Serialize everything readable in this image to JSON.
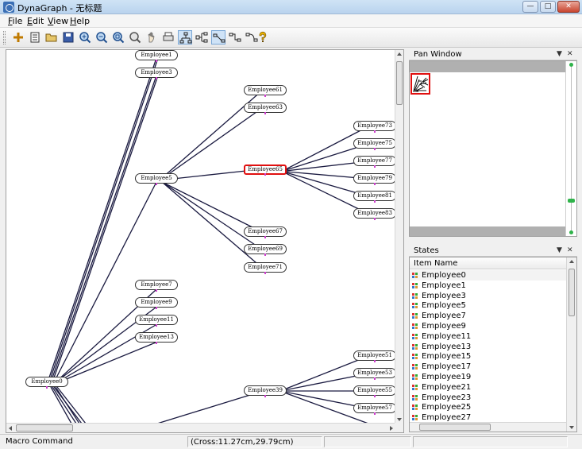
{
  "window": {
    "title": "DynaGraph - 无标题",
    "buttons": {
      "minimize": "—",
      "maximize": "□",
      "close": "✕"
    }
  },
  "menu": [
    "File",
    "Edit",
    "View",
    "Help"
  ],
  "toolbar": [
    {
      "name": "add-node",
      "icon": "plus-icon",
      "active": false
    },
    {
      "name": "properties",
      "icon": "document-list-icon",
      "active": false
    },
    {
      "name": "open",
      "icon": "folder-open-icon",
      "active": false
    },
    {
      "name": "save",
      "icon": "save-disk-icon",
      "active": false
    },
    {
      "name": "zoom-in",
      "icon": "zoom-in-icon",
      "active": false
    },
    {
      "name": "zoom-out",
      "icon": "zoom-out-icon",
      "active": false
    },
    {
      "name": "zoom-fit",
      "icon": "zoom-fit-icon",
      "active": false
    },
    {
      "name": "zoom-window",
      "icon": "zoom-window-icon",
      "active": false
    },
    {
      "name": "pan",
      "icon": "hand-icon",
      "active": false
    },
    {
      "name": "print",
      "icon": "printer-icon",
      "active": false
    },
    {
      "name": "layout-tree",
      "icon": "tree-layout-icon",
      "active": true
    },
    {
      "name": "layout-horizontal",
      "icon": "horizontal-layout-icon",
      "active": false
    },
    {
      "name": "connector",
      "icon": "connector-icon",
      "active": true
    },
    {
      "name": "connector-2",
      "icon": "connector-step-icon",
      "active": false
    },
    {
      "name": "connector-3",
      "icon": "connector-curve-icon",
      "active": false
    },
    {
      "name": "help",
      "icon": "help-icon",
      "active": false
    }
  ],
  "graph": {
    "nodes": {
      "employee1": "Employee1",
      "employee3": "Employee3",
      "employee5": "Employee5",
      "employee7": "Employee7",
      "employee9": "Employee9",
      "employee11": "Employee11",
      "employee13": "Employee13",
      "employee0": "Employee0",
      "employee39": "Employee39",
      "employee61": "Employee61",
      "employee63": "Employee63",
      "employee65": "Employee65",
      "employee67": "Employee67",
      "employee69": "Employee69",
      "employee71": "Employee71",
      "employee73": "Employee73",
      "employee75": "Employee75",
      "employee77": "Employee77",
      "employee79": "Employee79",
      "employee81": "Employee81",
      "employee83": "Employee83",
      "employee51": "Employee51",
      "employee53": "Employee53",
      "employee55": "Employee55",
      "employee57": "Employee57"
    },
    "selected": "Employee65"
  },
  "pan_window": {
    "title": "Pan Window"
  },
  "states": {
    "title": "States",
    "column": "Item Name",
    "items": [
      "Employee0",
      "Employee1",
      "Employee3",
      "Employee5",
      "Employee7",
      "Employee9",
      "Employee11",
      "Employee13",
      "Employee15",
      "Employee17",
      "Employee19",
      "Employee21",
      "Employee23",
      "Employee25",
      "Employee27"
    ],
    "highlighted": "Employee0"
  },
  "status": {
    "left": "Macro Command",
    "coords": "(Cross:11.27cm,29.79cm)"
  },
  "colors": {
    "edge": "#1a1a40",
    "selected": "#e01010",
    "pan_bg": "#b0b0b0",
    "pan_knob": "#2fb34a"
  }
}
